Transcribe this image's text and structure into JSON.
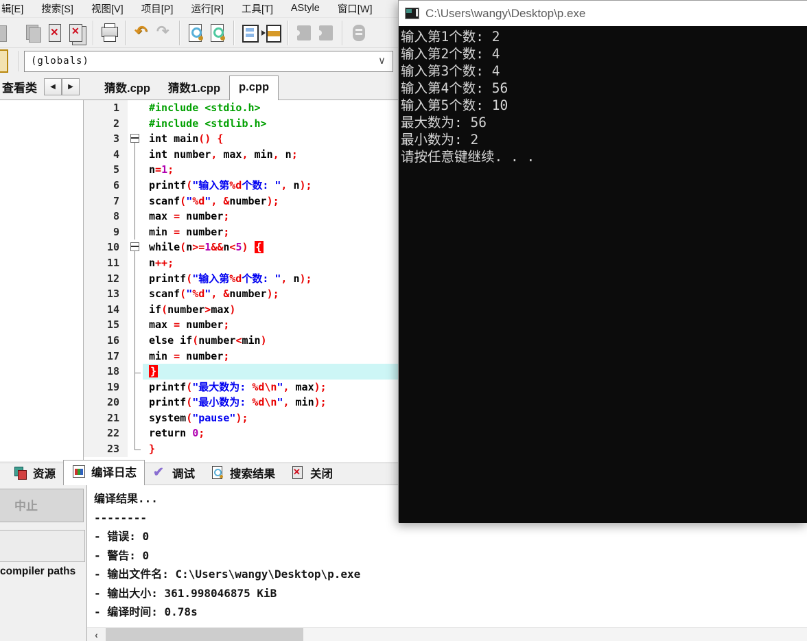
{
  "menu": {
    "items": [
      "辑[E]",
      "搜索[S]",
      "视图[V]",
      "项目[P]",
      "运行[R]",
      "工具[T]",
      "AStyle",
      "窗口[W]"
    ]
  },
  "toolbar": {
    "icons": [
      {
        "name": "doc-partial-icon"
      },
      {
        "name": "copy-docs-icon"
      },
      {
        "name": "close-file-icon"
      },
      {
        "name": "close-all-files-icon"
      },
      {
        "sep": true
      },
      {
        "name": "print-icon"
      },
      {
        "sep": true
      },
      {
        "name": "undo-icon"
      },
      {
        "name": "redo-icon"
      },
      {
        "sep": true
      },
      {
        "name": "find-icon"
      },
      {
        "name": "find-in-files-icon"
      },
      {
        "sep": true
      },
      {
        "name": "split-window-icon"
      },
      {
        "name": "window-arrange-icon"
      },
      {
        "sep": true
      },
      {
        "name": "puzzle-left-icon"
      },
      {
        "name": "puzzle-right-icon"
      },
      {
        "sep": true
      },
      {
        "name": "profile-icon"
      }
    ]
  },
  "navigator": {
    "value": "(globals)",
    "chevron": "∨"
  },
  "left_panel": {
    "tab_label": "查看类",
    "scroll_left": "◀",
    "scroll_right": "▶"
  },
  "editor": {
    "tabs": [
      {
        "label": "猜数.cpp",
        "active": false
      },
      {
        "label": "猜数1.cpp",
        "active": false
      },
      {
        "label": "p.cpp",
        "active": true
      }
    ],
    "lines": [
      {
        "n": 1,
        "m": "",
        "segs": [
          [
            "inc",
            "#include <stdio.h>"
          ]
        ]
      },
      {
        "n": 2,
        "m": "",
        "segs": [
          [
            "inc",
            "#include <stdlib.h>"
          ]
        ]
      },
      {
        "n": 3,
        "m": "box",
        "segs": [
          [
            "kw",
            "int "
          ],
          [
            "id",
            "main"
          ],
          [
            "sym",
            "() {"
          ]
        ]
      },
      {
        "n": 4,
        "m": "line",
        "segs": [
          [
            "kw",
            "int "
          ],
          [
            "id",
            "number"
          ],
          [
            "sym",
            ","
          ],
          [
            "id",
            " max"
          ],
          [
            "sym",
            ","
          ],
          [
            "id",
            " min"
          ],
          [
            "sym",
            ","
          ],
          [
            "id",
            " n"
          ],
          [
            "sym",
            ";"
          ]
        ]
      },
      {
        "n": 5,
        "m": "line",
        "segs": [
          [
            "id",
            "n"
          ],
          [
            "sym",
            "="
          ],
          [
            "num",
            "1"
          ],
          [
            "sym",
            ";"
          ]
        ]
      },
      {
        "n": 6,
        "m": "line",
        "segs": [
          [
            "id",
            "printf"
          ],
          [
            "sym",
            "("
          ],
          [
            "str",
            "\"输入第"
          ],
          [
            "fmt",
            "%d"
          ],
          [
            "str",
            "个数: \""
          ],
          [
            "sym",
            ","
          ],
          [
            "id",
            " n"
          ],
          [
            "sym",
            ");"
          ]
        ]
      },
      {
        "n": 7,
        "m": "line",
        "segs": [
          [
            "id",
            "scanf"
          ],
          [
            "sym",
            "("
          ],
          [
            "str",
            "\""
          ],
          [
            "fmt",
            "%d"
          ],
          [
            "str",
            "\""
          ],
          [
            "sym",
            ", &"
          ],
          [
            "id",
            "number"
          ],
          [
            "sym",
            ");"
          ]
        ]
      },
      {
        "n": 8,
        "m": "line",
        "segs": [
          [
            "id",
            "max "
          ],
          [
            "sym",
            "="
          ],
          [
            "id",
            " number"
          ],
          [
            "sym",
            ";"
          ]
        ]
      },
      {
        "n": 9,
        "m": "line",
        "segs": [
          [
            "id",
            "min "
          ],
          [
            "sym",
            "="
          ],
          [
            "id",
            " number"
          ],
          [
            "sym",
            ";"
          ]
        ]
      },
      {
        "n": 10,
        "m": "box",
        "segs": [
          [
            "kw",
            "while"
          ],
          [
            "sym",
            "("
          ],
          [
            "id",
            "n"
          ],
          [
            "sym",
            ">="
          ],
          [
            "num",
            "1"
          ],
          [
            "sym",
            "&&"
          ],
          [
            "id",
            "n"
          ],
          [
            "sym",
            "<"
          ],
          [
            "num",
            "5"
          ],
          [
            "sym",
            ") "
          ],
          [
            "brace",
            "{"
          ]
        ]
      },
      {
        "n": 11,
        "m": "line",
        "segs": [
          [
            "id",
            "n"
          ],
          [
            "sym",
            "++;"
          ]
        ]
      },
      {
        "n": 12,
        "m": "line",
        "segs": [
          [
            "id",
            "printf"
          ],
          [
            "sym",
            "("
          ],
          [
            "str",
            "\"输入第"
          ],
          [
            "fmt",
            "%d"
          ],
          [
            "str",
            "个数: \""
          ],
          [
            "sym",
            ","
          ],
          [
            "id",
            " n"
          ],
          [
            "sym",
            ");"
          ]
        ]
      },
      {
        "n": 13,
        "m": "line",
        "segs": [
          [
            "id",
            "scanf"
          ],
          [
            "sym",
            "("
          ],
          [
            "str",
            "\""
          ],
          [
            "fmt",
            "%d"
          ],
          [
            "str",
            "\""
          ],
          [
            "sym",
            ", &"
          ],
          [
            "id",
            "number"
          ],
          [
            "sym",
            ");"
          ]
        ]
      },
      {
        "n": 14,
        "m": "line",
        "segs": [
          [
            "kw",
            "if"
          ],
          [
            "sym",
            "("
          ],
          [
            "id",
            "number"
          ],
          [
            "sym",
            ">"
          ],
          [
            "id",
            "max"
          ],
          [
            "sym",
            ")"
          ]
        ]
      },
      {
        "n": 15,
        "m": "line",
        "segs": [
          [
            "id",
            "max "
          ],
          [
            "sym",
            "="
          ],
          [
            "id",
            " number"
          ],
          [
            "sym",
            ";"
          ]
        ]
      },
      {
        "n": 16,
        "m": "line",
        "segs": [
          [
            "kw",
            "else if"
          ],
          [
            "sym",
            "("
          ],
          [
            "id",
            "number"
          ],
          [
            "sym",
            "<"
          ],
          [
            "id",
            "min"
          ],
          [
            "sym",
            ")"
          ]
        ]
      },
      {
        "n": 17,
        "m": "line",
        "segs": [
          [
            "id",
            "min "
          ],
          [
            "sym",
            "="
          ],
          [
            "id",
            " number"
          ],
          [
            "sym",
            ";"
          ]
        ]
      },
      {
        "n": 18,
        "m": "tick",
        "cur": true,
        "segs": [
          [
            "brace",
            "}"
          ]
        ]
      },
      {
        "n": 19,
        "m": "line",
        "segs": [
          [
            "id",
            "printf"
          ],
          [
            "sym",
            "("
          ],
          [
            "str",
            "\"最大数为: "
          ],
          [
            "fmt",
            "%d\\n"
          ],
          [
            "str",
            "\""
          ],
          [
            "sym",
            ","
          ],
          [
            "id",
            " max"
          ],
          [
            "sym",
            ");"
          ]
        ]
      },
      {
        "n": 20,
        "m": "line",
        "segs": [
          [
            "id",
            "printf"
          ],
          [
            "sym",
            "("
          ],
          [
            "str",
            "\"最小数为: "
          ],
          [
            "fmt",
            "%d\\n"
          ],
          [
            "str",
            "\""
          ],
          [
            "sym",
            ","
          ],
          [
            "id",
            " min"
          ],
          [
            "sym",
            ");"
          ]
        ]
      },
      {
        "n": 21,
        "m": "line",
        "segs": [
          [
            "id",
            "system"
          ],
          [
            "sym",
            "("
          ],
          [
            "str",
            "\"pause\""
          ],
          [
            "sym",
            ");"
          ]
        ]
      },
      {
        "n": 22,
        "m": "line",
        "segs": [
          [
            "kw",
            "return "
          ],
          [
            "num",
            "0"
          ],
          [
            "sym",
            ";"
          ]
        ]
      },
      {
        "n": 23,
        "m": "end",
        "segs": [
          [
            "sym",
            "}"
          ]
        ]
      }
    ]
  },
  "console": {
    "title": "C:\\Users\\wangy\\Desktop\\p.exe",
    "lines": [
      "输入第1个数: 2",
      "输入第2个数: 4",
      "输入第3个数: 4",
      "输入第4个数: 56",
      "输入第5个数: 10",
      "最大数为: 56",
      "最小数为: 2",
      "请按任意键继续. . ."
    ]
  },
  "bottom_tabs": {
    "items": [
      {
        "label": "资源",
        "icon": "resources-icon",
        "active": false
      },
      {
        "label": "编译日志",
        "icon": "compile-log-icon",
        "active": true
      },
      {
        "label": "调试",
        "icon": "debug-icon",
        "active": false
      },
      {
        "label": "搜索结果",
        "icon": "search-results-icon",
        "active": false
      },
      {
        "label": "关闭",
        "icon": "close-icon",
        "active": false
      }
    ]
  },
  "compile_log": {
    "lines": [
      "编译结果...",
      "--------",
      "- 错误: 0",
      "- 警告: 0",
      "- 输出文件名: C:\\Users\\wangy\\Desktop\\p.exe",
      "- 输出大小: 361.998046875 KiB",
      "- 编译时间: 0.78s"
    ]
  },
  "bottom_left": {
    "abort_label": "中止",
    "compiler_paths_label": "compiler paths"
  },
  "scrollbar": {
    "left_arrow": "‹"
  },
  "colors": {
    "string": "#0000f0",
    "symbol": "#e80000",
    "number": "#b000b0",
    "include": "#00a000",
    "current_line": "#cdf6f6",
    "brace_match_bg": "#ff0000",
    "console_bg": "#0c0c0c",
    "chrome_bg": "#f0f0f0"
  }
}
